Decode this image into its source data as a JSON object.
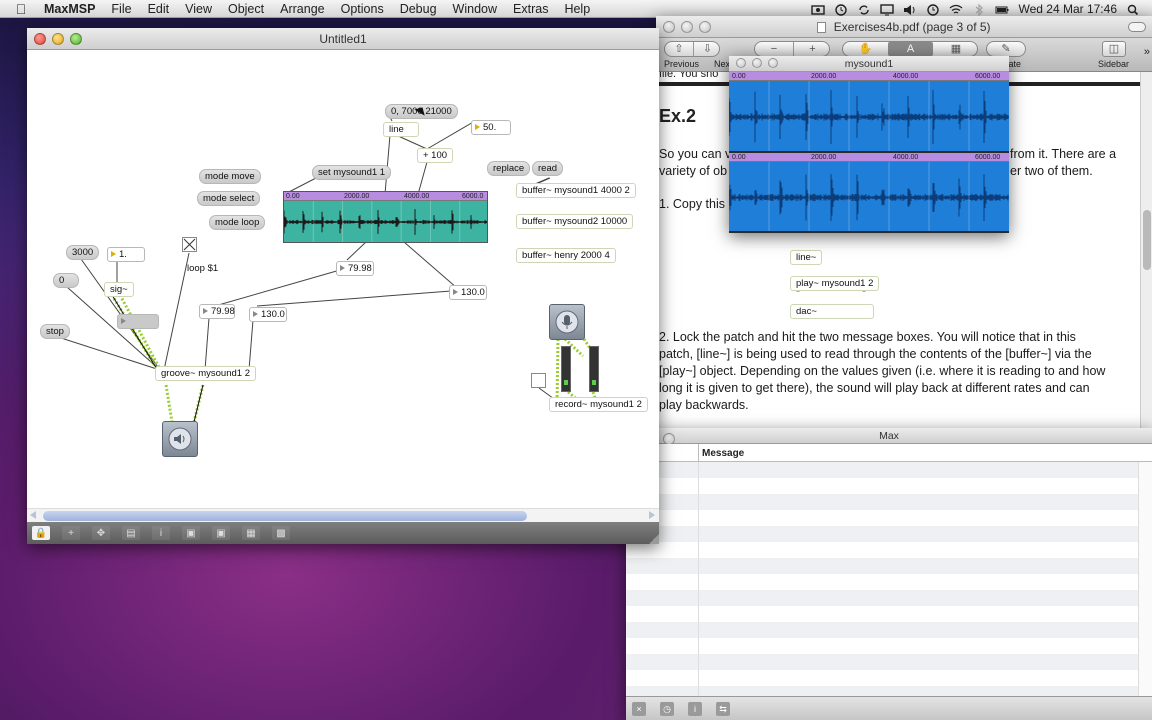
{
  "menubar": {
    "app": "MaxMSP",
    "items": [
      "File",
      "Edit",
      "View",
      "Object",
      "Arrange",
      "Options",
      "Debug",
      "Window",
      "Extras",
      "Help"
    ],
    "clock": "Wed 24 Mar  17:46"
  },
  "patcher": {
    "title": "Untitled1",
    "objects": {
      "msg_line_target": "0, 7000 21000",
      "line": "line",
      "num_50": "50.",
      "plus_100": "+ 100",
      "set_mysound": "set mysound1 1",
      "mode_move": "mode move",
      "mode_select": "mode select",
      "mode_loop": "mode loop",
      "replace": "replace",
      "read": "read",
      "buffer_mysound1": "buffer~ mysound1 4000 2",
      "buffer_mysound2": "buffer~ mysound2 10000",
      "buffer_henry": "buffer~ henry 2000 4",
      "msg_3000": "3000",
      "num_1": "1.",
      "msg_0": "0",
      "sig": "sig~",
      "msg_stop": "stop",
      "loop": "loop $1",
      "num_7998a": "79.98",
      "num_7998b": "79.98",
      "num_130a": "130.0",
      "num_130b": "130.0",
      "num_empty": "",
      "groove": "groove~ mysound1 2",
      "record": "record~ mysound1 2"
    },
    "waveform_ruler": [
      "0.00",
      "2000.00",
      "4000.00",
      "6000.0"
    ]
  },
  "preview": {
    "title": "Exercises4b.pdf (page 3 of 5)",
    "toolbar": {
      "previous": "Previous",
      "next": "Nex",
      "rotate": "tate",
      "sidebar": "Sidebar"
    },
    "page": {
      "cutoff": "file. You sho",
      "heading": "Ex.2",
      "p1a": "So you can v",
      "p1b": "from it. There are a",
      "p2a": "variety of ob",
      "p2b": "er two of them.",
      "step1": "1. Copy this",
      "patch_line": "line~",
      "patch_play": "play~ mysound1 2",
      "patch_dac": "dac~",
      "step2_lines": [
        "2. Lock the patch and hit the two message boxes. You will notice that in this",
        "patch, [line~] is being used to read through the contents of the [buffer~] via the",
        "[play~] object. Depending on the values given (i.e. where it is reading to and how",
        "long it is given to get there), the sound will play back at different rates and can",
        "play backwards."
      ]
    }
  },
  "buffer_window": {
    "title": "mysound1",
    "ruler": [
      "0.00",
      "2000.00",
      "4000.00",
      "6000.00"
    ]
  },
  "max_window": {
    "title": "Max",
    "column": "Message"
  },
  "colors": {
    "waveform_patch": "#3db3a2",
    "waveform_buffer": "#1f7ed8",
    "ruler": "#b88ce0",
    "patch_cord_signal": "#9acd32"
  }
}
